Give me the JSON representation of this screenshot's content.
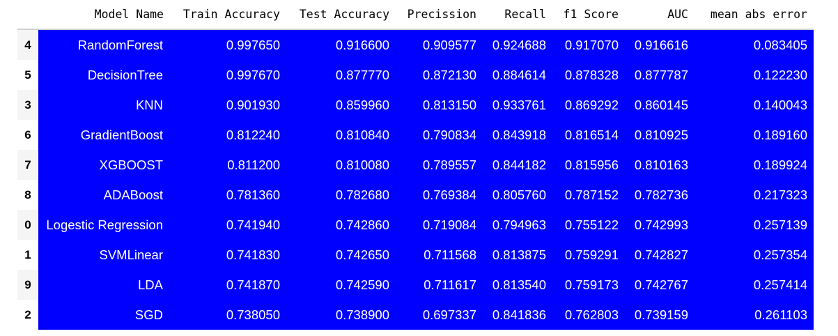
{
  "table": {
    "columns": [
      "",
      "Model Name",
      "Train Accuracy",
      "Test Accuracy",
      "Precission",
      "Recall",
      "f1 Score",
      "AUC",
      "mean abs error"
    ],
    "rows": [
      {
        "index": "4",
        "model_name": "RandomForest",
        "train_accuracy": "0.997650",
        "test_accuracy": "0.916600",
        "precission": "0.909577",
        "recall": "0.924688",
        "f1_score": "0.917070",
        "auc": "0.916616",
        "mean_abs_error": "0.083405"
      },
      {
        "index": "5",
        "model_name": "DecisionTree",
        "train_accuracy": "0.997670",
        "test_accuracy": "0.877770",
        "precission": "0.872130",
        "recall": "0.884614",
        "f1_score": "0.878328",
        "auc": "0.877787",
        "mean_abs_error": "0.122230"
      },
      {
        "index": "3",
        "model_name": "KNN",
        "train_accuracy": "0.901930",
        "test_accuracy": "0.859960",
        "precission": "0.813150",
        "recall": "0.933761",
        "f1_score": "0.869292",
        "auc": "0.860145",
        "mean_abs_error": "0.140043"
      },
      {
        "index": "6",
        "model_name": "GradientBoost",
        "train_accuracy": "0.812240",
        "test_accuracy": "0.810840",
        "precission": "0.790834",
        "recall": "0.843918",
        "f1_score": "0.816514",
        "auc": "0.810925",
        "mean_abs_error": "0.189160"
      },
      {
        "index": "7",
        "model_name": "XGBOOST",
        "train_accuracy": "0.811200",
        "test_accuracy": "0.810080",
        "precission": "0.789557",
        "recall": "0.844182",
        "f1_score": "0.815956",
        "auc": "0.810163",
        "mean_abs_error": "0.189924"
      },
      {
        "index": "8",
        "model_name": "ADABoost",
        "train_accuracy": "0.781360",
        "test_accuracy": "0.782680",
        "precission": "0.769384",
        "recall": "0.805760",
        "f1_score": "0.787152",
        "auc": "0.782736",
        "mean_abs_error": "0.217323"
      },
      {
        "index": "0",
        "model_name": "Logestic Regression",
        "train_accuracy": "0.741940",
        "test_accuracy": "0.742860",
        "precission": "0.719084",
        "recall": "0.794963",
        "f1_score": "0.755122",
        "auc": "0.742993",
        "mean_abs_error": "0.257139"
      },
      {
        "index": "1",
        "model_name": "SVMLinear",
        "train_accuracy": "0.741830",
        "test_accuracy": "0.742650",
        "precission": "0.711568",
        "recall": "0.813875",
        "f1_score": "0.759291",
        "auc": "0.742827",
        "mean_abs_error": "0.257354"
      },
      {
        "index": "9",
        "model_name": "LDA",
        "train_accuracy": "0.741870",
        "test_accuracy": "0.742590",
        "precission": "0.711617",
        "recall": "0.813540",
        "f1_score": "0.759173",
        "auc": "0.742767",
        "mean_abs_error": "0.257414"
      },
      {
        "index": "2",
        "model_name": "SGD",
        "train_accuracy": "0.738050",
        "test_accuracy": "0.738900",
        "precission": "0.697337",
        "recall": "0.841836",
        "f1_score": "0.762803",
        "auc": "0.739159",
        "mean_abs_error": "0.261103"
      }
    ]
  },
  "colors": {
    "highlight_background": "#0000ff",
    "highlight_text": "#ffffff",
    "header_text": "#000000",
    "index_text": "#000000",
    "page_background": "#ffffff"
  }
}
